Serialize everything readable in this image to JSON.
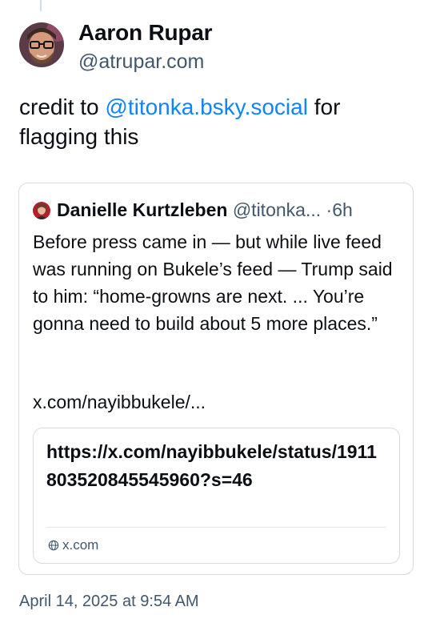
{
  "post": {
    "author_name": "Aaron Rupar",
    "author_handle": "@atrupar.com",
    "text_prefix": "credit to ",
    "mention": "@titonka.bsky.social",
    "text_suffix": " for flagging this",
    "timestamp": "April 14, 2025 at 9:54 AM"
  },
  "quote": {
    "author_name": "Danielle Kurtzleben",
    "author_handle": "@titonka...",
    "separator": "·",
    "age": "6h",
    "text": "Before press came in — but while live feed was running on Bukele’s feed — Trump said to him: “home-growns are next. ... You’re gonna need to build about 5 more places.”",
    "link_text": "x.com/nayibbukele/...",
    "embed": {
      "title": "https://x.com/nayibbukele/status/1911803520845545960?s=46",
      "domain": "x.com"
    }
  },
  "colors": {
    "mention": "#1083fe",
    "secondary_text": "#42576c",
    "border": "#d4dbe2"
  },
  "icons": {
    "avatar": "user-avatar-glasses",
    "quote_avatar": "user-avatar",
    "domain_icon": "globe-icon"
  }
}
